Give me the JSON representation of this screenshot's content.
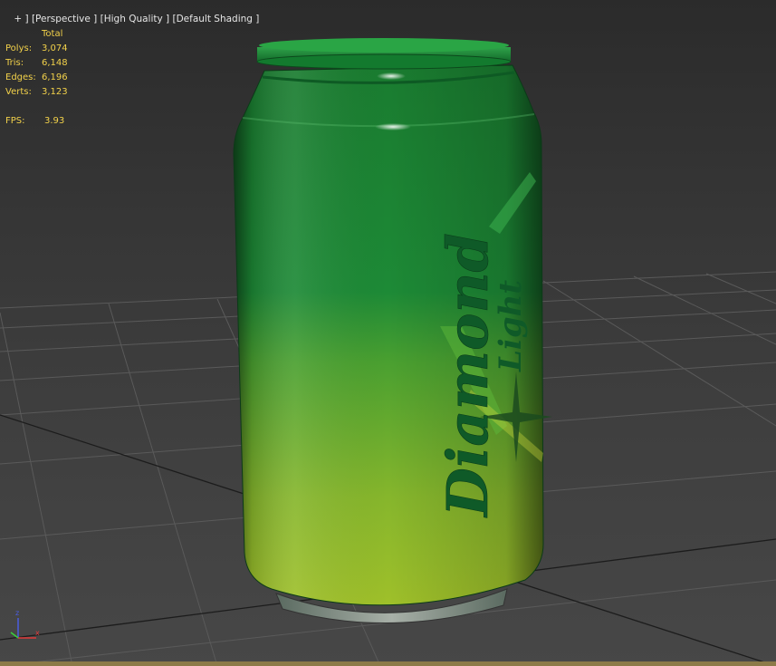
{
  "viewport": {
    "label_prefix": "+ ]",
    "view_mode": "[Perspective ]",
    "quality": "[High Quality ]",
    "shading": "[Default Shading ]"
  },
  "stats": {
    "header": "Total",
    "rows": [
      {
        "label": "Polys:",
        "value": "3,074"
      },
      {
        "label": "Tris:",
        "value": "6,148"
      },
      {
        "label": "Edges:",
        "value": "6,196"
      },
      {
        "label": "Verts:",
        "value": "3,123"
      }
    ],
    "fps_label": "FPS:",
    "fps_value": "3.93"
  },
  "can": {
    "brand": "Diamond",
    "subbrand": "Light",
    "color_top": "#1e8a36",
    "color_bottom": "#9bbd2a",
    "text_color": "#0f5a28"
  },
  "gizmo": {
    "z_label": "z",
    "x_label": "x",
    "z_color": "#4a5de0",
    "x_color": "#e03a3a",
    "y_color": "#3ad03a"
  }
}
